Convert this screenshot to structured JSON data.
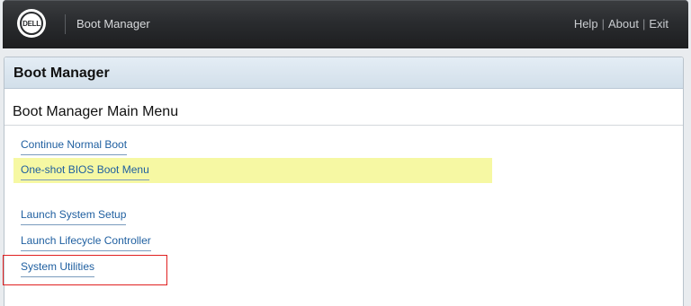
{
  "header": {
    "logo_text": "DELL",
    "app_title": "Boot Manager",
    "links": {
      "help": "Help",
      "about": "About",
      "exit": "Exit",
      "separator": "|"
    }
  },
  "panel": {
    "title": "Boot Manager",
    "section_title": "Boot Manager Main Menu",
    "menu_items": [
      {
        "label": "Continue Normal Boot"
      },
      {
        "label": "One-shot BIOS Boot Menu",
        "highlighted": true
      },
      {
        "label": "Launch System Setup"
      },
      {
        "label": "Launch Lifecycle Controller"
      },
      {
        "label": "System Utilities",
        "annotated": true
      }
    ]
  },
  "colors": {
    "topbar": "#2a2c2f",
    "link": "#1f5fa0",
    "highlight": "#f6f8a3",
    "annotation_box": "#e02020"
  }
}
